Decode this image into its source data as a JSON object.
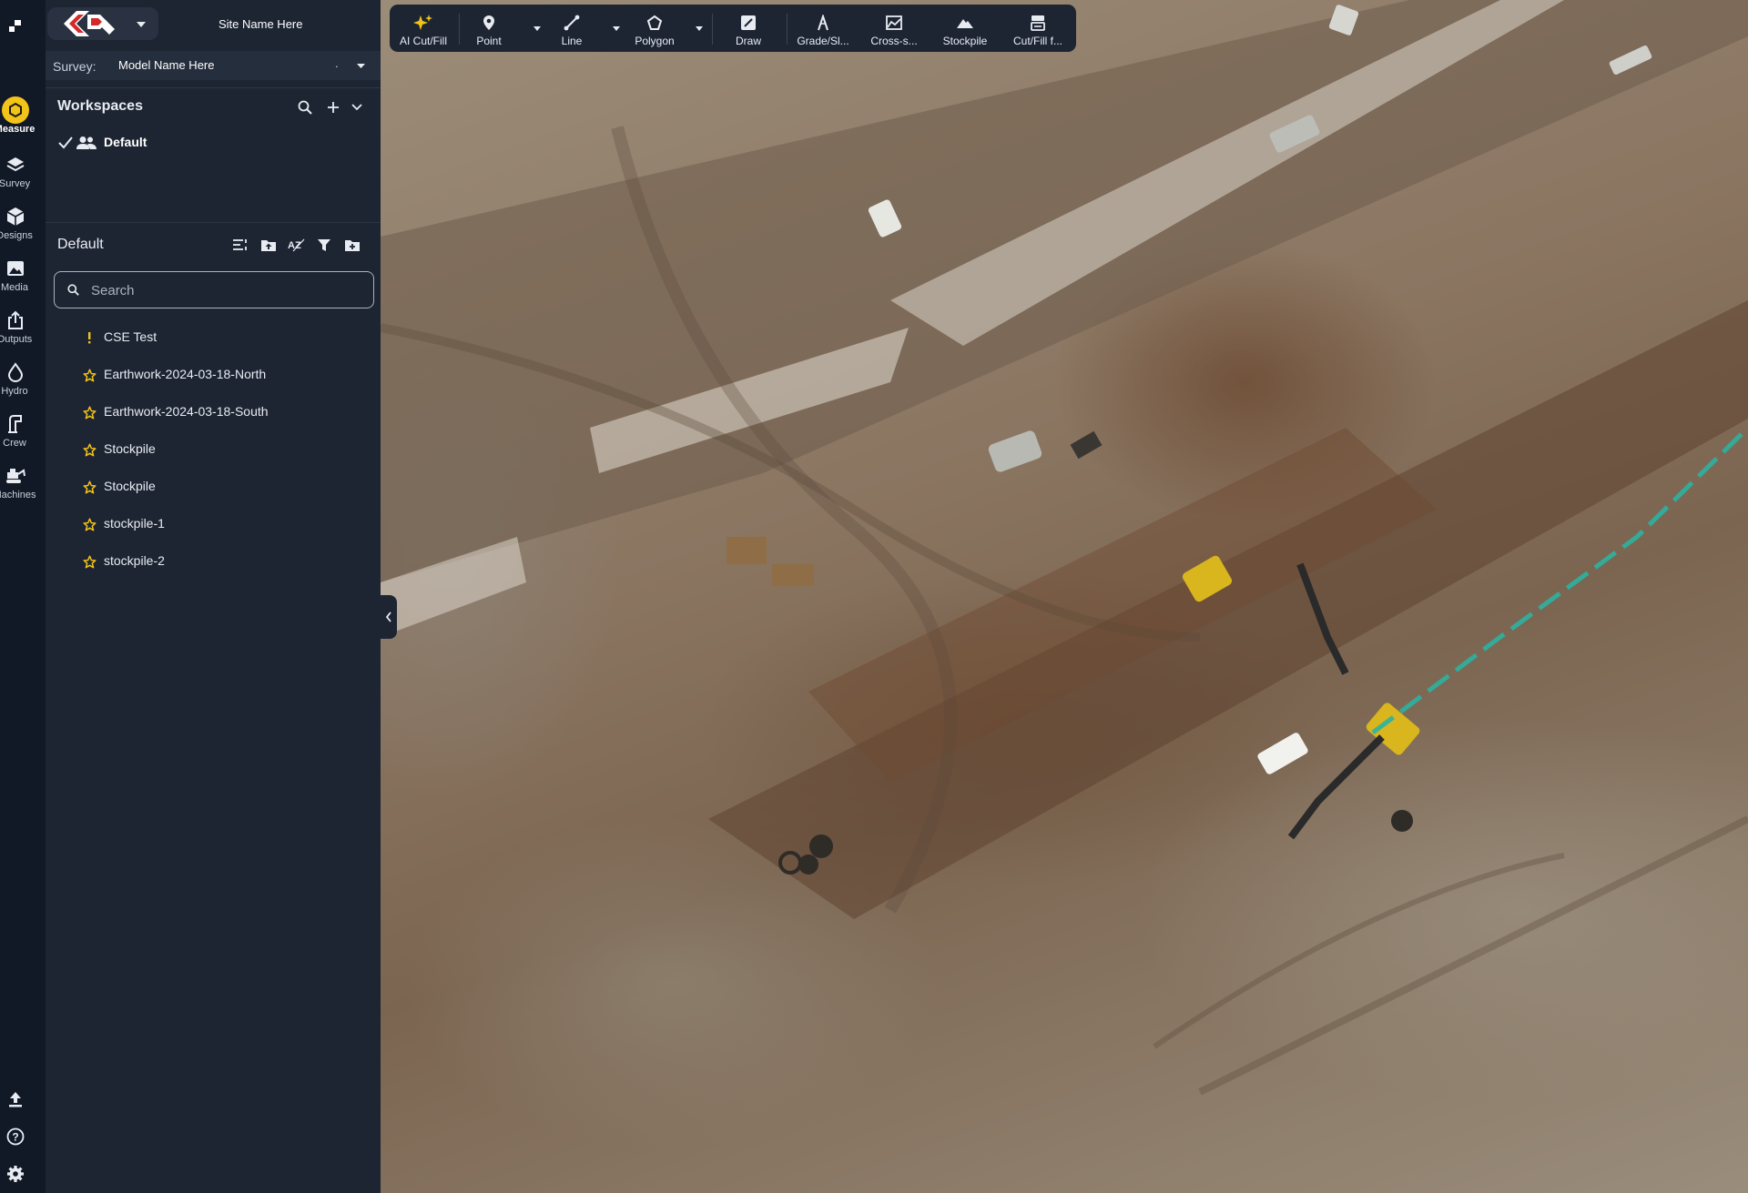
{
  "rail": {
    "items": [
      {
        "label": "Measure",
        "icon": "measure-icon"
      },
      {
        "label": "Survey",
        "icon": "layers-icon"
      },
      {
        "label": "Designs",
        "icon": "cube-icon"
      },
      {
        "label": "Media",
        "icon": "image-icon"
      },
      {
        "label": "Outputs",
        "icon": "export-icon"
      },
      {
        "label": "Hydro",
        "icon": "water-drop-icon"
      },
      {
        "label": "Crew",
        "icon": "crew-icon"
      },
      {
        "label": "Machines",
        "icon": "machine-icon"
      }
    ],
    "bottom": [
      "upload-icon",
      "help-icon",
      "settings-icon"
    ]
  },
  "header": {
    "site_name": "Site Name Here",
    "survey_label": "Survey:",
    "model_name": "Model Name Here",
    "model_suffix": "."
  },
  "workspaces": {
    "title": "Workspaces",
    "items": [
      {
        "label": "Default",
        "selected": true
      }
    ]
  },
  "layers": {
    "title": "Default",
    "search_placeholder": "Search",
    "items": [
      {
        "label": "CSE Test",
        "icon": "exclamation-icon"
      },
      {
        "label": "Earthwork-2024-03-18-North",
        "icon": "star-icon"
      },
      {
        "label": "Earthwork-2024-03-18-South",
        "icon": "star-icon"
      },
      {
        "label": "Stockpile",
        "icon": "star-icon"
      },
      {
        "label": "Stockpile",
        "icon": "star-icon"
      },
      {
        "label": "stockpile-1",
        "icon": "star-icon"
      },
      {
        "label": "stockpile-2",
        "icon": "star-icon"
      }
    ]
  },
  "toolbar": {
    "tools": [
      {
        "label": "AI Cut/Fill",
        "icon": "sparkle-icon"
      },
      {
        "label": "Point",
        "icon": "pin-icon"
      },
      {
        "label": "Line",
        "icon": "line-icon"
      },
      {
        "label": "Polygon",
        "icon": "polygon-icon"
      },
      {
        "label": "Draw",
        "icon": "pencil-icon"
      },
      {
        "label": "Grade/Sl...",
        "icon": "grade-icon"
      },
      {
        "label": "Cross-s...",
        "icon": "cross-section-icon"
      },
      {
        "label": "Stockpile",
        "icon": "stockpile-icon"
      },
      {
        "label": "Cut/Fill f...",
        "icon": "cut-fill-icon"
      }
    ]
  },
  "colors": {
    "accent": "#f3c318",
    "panel": "#1d2533",
    "rail": "#111826"
  }
}
